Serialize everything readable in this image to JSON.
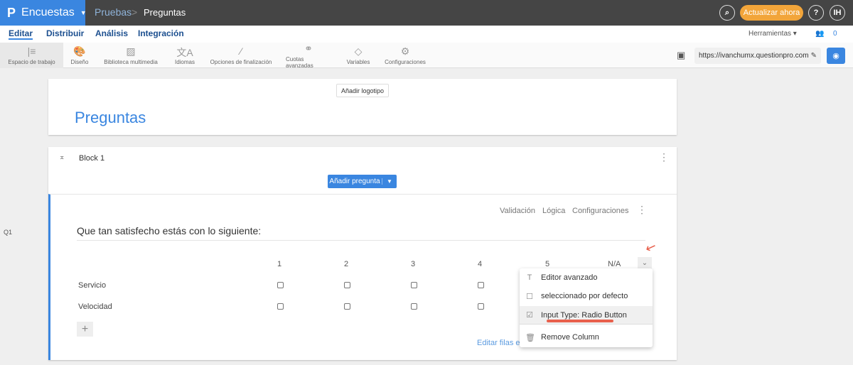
{
  "header": {
    "app": "Encuestas",
    "crumb_parent": "Pruebas",
    "crumb_sep": ">",
    "crumb_current": "Preguntas",
    "update_label": "Actualizar ahora",
    "help": "?",
    "avatar": "IH"
  },
  "nav": {
    "tabs": [
      "Editar",
      "Distribuir",
      "Análisis",
      "Integración"
    ],
    "tools_label": "Herramientas",
    "collab_count": "0"
  },
  "toolbar": {
    "items": [
      "Espacio de trabajo",
      "Diseño",
      "Biblioteca multimedia",
      "Idiomas",
      "Opciones de finalización",
      "Cuotas avanzadas",
      "Variables",
      "Configuraciones"
    ],
    "url": "https://ivanchumx.questionpro.com"
  },
  "survey": {
    "add_logo": "Añadir logotipo",
    "title": "Preguntas",
    "block_name": "Block 1",
    "add_question": "Añadir pregunta"
  },
  "question": {
    "number": "Q1",
    "links": [
      "Validación",
      "Lógica",
      "Configuraciones"
    ],
    "text": "Que tan satisfecho estás con lo siguiente:",
    "columns": [
      "1",
      "2",
      "3",
      "4",
      "5",
      "N/A"
    ],
    "rows": [
      "Servicio",
      "Velocidad"
    ],
    "edit_rows": "Editar filas en"
  },
  "menu": {
    "items": [
      "Editor avanzado",
      "seleccionado por defecto",
      "Input Type: Radio Button",
      "Remove Column"
    ]
  },
  "colors": {
    "accent": "#3a86e0",
    "update": "#f2a53a",
    "annotation": "#e8604c"
  }
}
